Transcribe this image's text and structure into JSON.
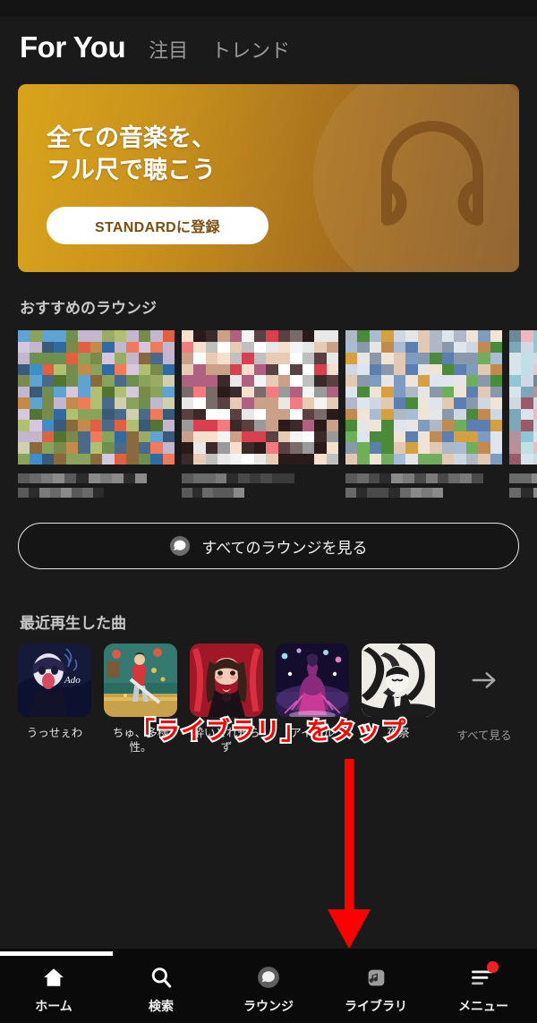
{
  "header": {
    "title": "For You",
    "tabs": [
      {
        "label": "注目"
      },
      {
        "label": "トレンド"
      }
    ]
  },
  "banner": {
    "line1": "全ての音楽を、",
    "line2": "フル尺で聴こう",
    "cta_label": "STANDARDに登録",
    "icon": "headphones-icon",
    "gradient_from": "#d9a41b",
    "gradient_to": "#8a5a26",
    "cta_text_color": "#7a4f10"
  },
  "lounge": {
    "section_title": "おすすめのラウンジ",
    "cards": [
      {
        "name": "lounge-card-1"
      },
      {
        "name": "lounge-card-2"
      },
      {
        "name": "lounge-card-3"
      },
      {
        "name": "lounge-card-4"
      }
    ],
    "see_all_label": "すべてのラウンジを見る",
    "see_all_icon": "chat-bubble-icon"
  },
  "recent": {
    "section_title": "最近再生した曲",
    "tracks": [
      {
        "title": "うっせぇわ",
        "art": "ado-usseewa"
      },
      {
        "title": "ちゅ、多様性。",
        "art": "chu-tayousei"
      },
      {
        "title": "酔いどれ知らず",
        "art": "yoidore-shirazu"
      },
      {
        "title": "アイドル",
        "art": "idol"
      },
      {
        "title": "夜祭",
        "art": "yomatsuri"
      }
    ],
    "see_all_label": "すべて見る",
    "see_all_icon": "arrow-right-icon"
  },
  "annotation": {
    "text": "「ライブラリ」をタップ",
    "text_color": "#ff0000",
    "outline_color": "#ffffff",
    "arrow_color": "#ff0000",
    "highlight_color": "#ff0000",
    "highlight_target": "ライブラリ"
  },
  "bottom_nav": {
    "items": [
      {
        "label": "ホーム",
        "icon": "home-icon",
        "active": true,
        "badge": false
      },
      {
        "label": "検索",
        "icon": "search-icon",
        "active": false,
        "badge": false
      },
      {
        "label": "ラウンジ",
        "icon": "lounge-icon",
        "active": false,
        "badge": false
      },
      {
        "label": "ライブラリ",
        "icon": "library-icon",
        "active": false,
        "badge": false
      },
      {
        "label": "メニュー",
        "icon": "menu-icon",
        "active": false,
        "badge": true
      }
    ]
  }
}
